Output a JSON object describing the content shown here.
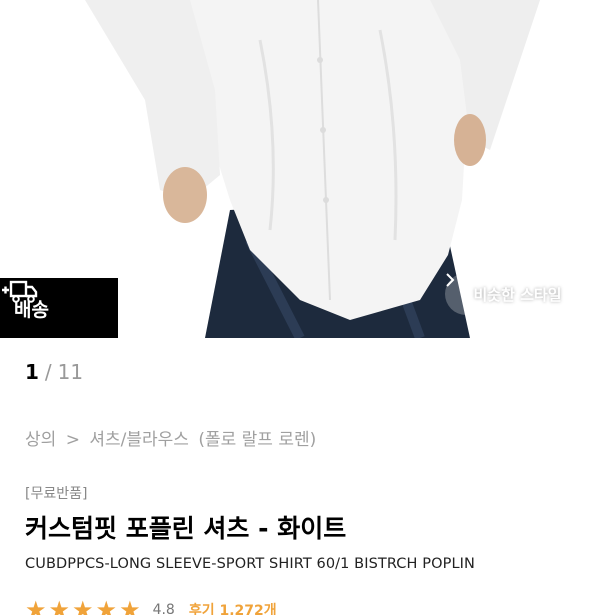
{
  "hero": {
    "delivery_label": "배송",
    "similar_style_label": "비슷한 스타일"
  },
  "pager": {
    "current": "1",
    "separator": "/",
    "total": "11"
  },
  "breadcrumb": [
    "상의",
    ">",
    "셔츠/블라우스",
    "(폴로 랄프 로렌)"
  ],
  "product": {
    "badge": "[무료반품]",
    "title": "커스텀핏 포플린 셔츠 - 화이트",
    "subtitle": "CUBDPPCS-LONG SLEEVE-SPORT SHIRT 60/1 BISTRCH POPLIN"
  },
  "rating": {
    "score": "4.8",
    "review_count": "후기 1,272개",
    "stars": 5
  },
  "colors": {
    "accent": "#f0a33a",
    "badge_bg": "#000000"
  }
}
